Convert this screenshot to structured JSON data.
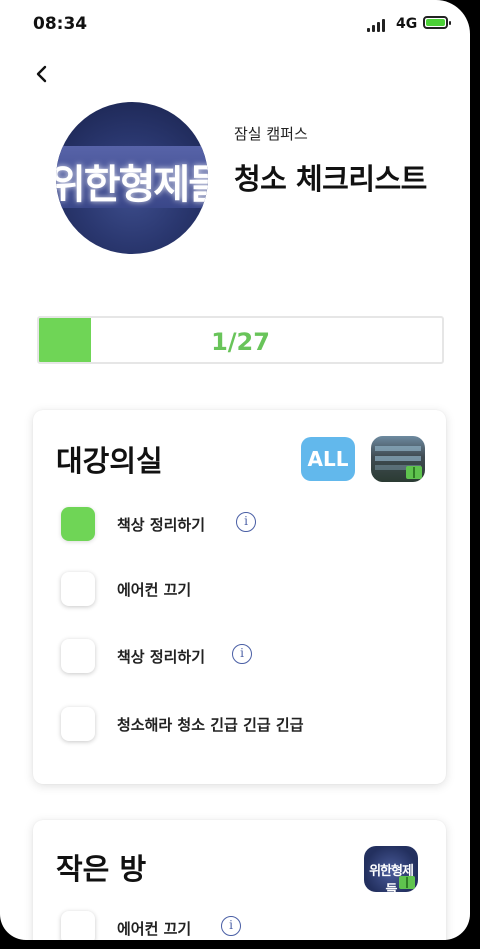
{
  "status_bar": {
    "time": "08:34",
    "network": "4G"
  },
  "header": {
    "campus": "잠실 캠퍼스",
    "title": "청소 체크리스트",
    "logo_text": "위한형제들"
  },
  "progress": {
    "label": "1/27",
    "completed": 1,
    "total": 27
  },
  "sections": [
    {
      "title": "대강의실",
      "all_button": "ALL",
      "items": [
        {
          "label": "책상 정리하기",
          "checked": true,
          "info": true
        },
        {
          "label": "에어컨 끄기",
          "checked": false,
          "info": false
        },
        {
          "label": "책상 정리하기",
          "checked": false,
          "info": true
        },
        {
          "label": "청소해라 청소 긴급 긴급 긴급",
          "checked": false,
          "info": false
        }
      ]
    },
    {
      "title": "작은 방",
      "thumb_text": "위한형제들",
      "items": [
        {
          "label": "에어컨 끄기",
          "checked": false,
          "info": true
        }
      ]
    }
  ],
  "colors": {
    "accent_green": "#6fd556",
    "progress_text": "#69c45a",
    "all_button": "#62b8ec",
    "info_icon": "#4a5fa5"
  },
  "icons": {
    "back": "chevron-left-icon",
    "info": "info-icon",
    "signal": "signal-icon",
    "battery": "battery-icon"
  }
}
